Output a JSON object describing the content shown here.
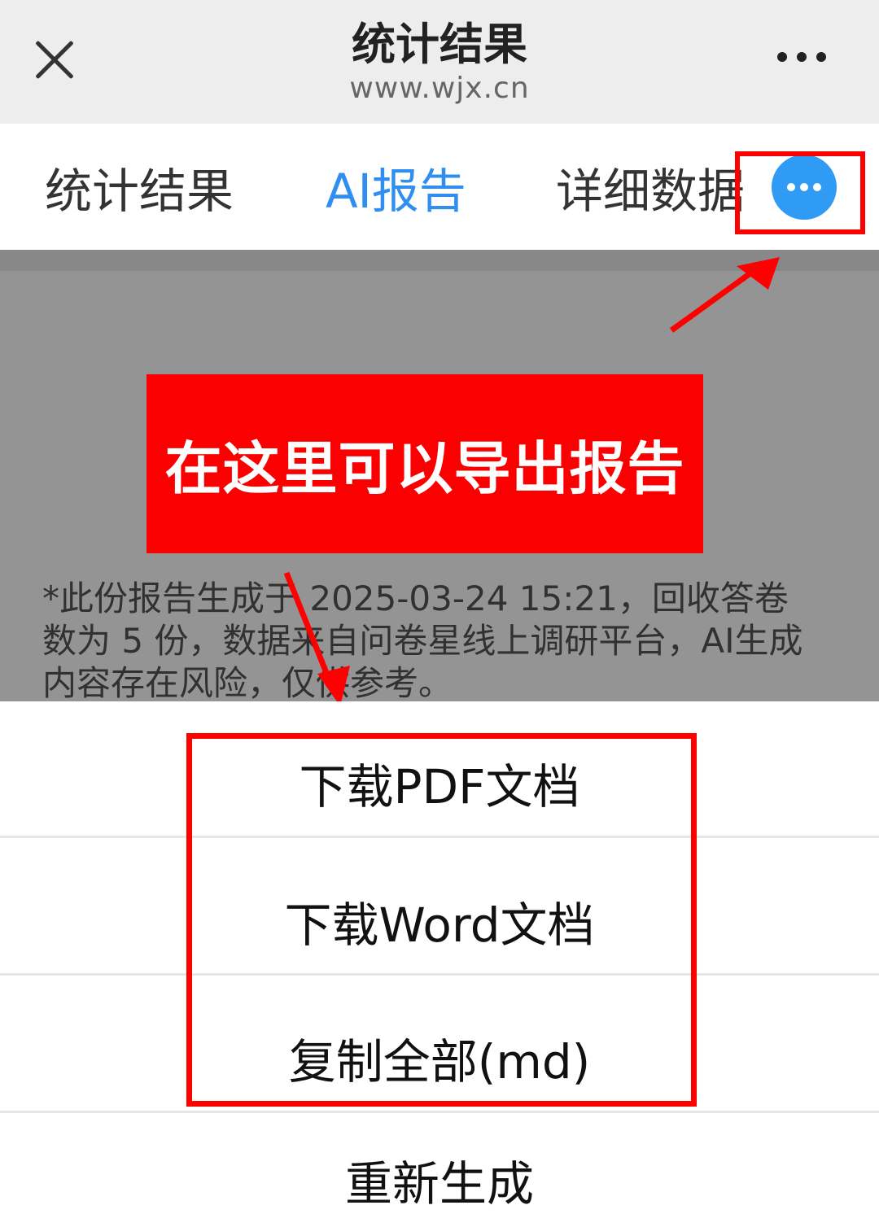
{
  "titlebar": {
    "title": "统计结果",
    "url": "www.wjx.cn",
    "close_icon": "close-icon",
    "more_icon": "more-horizontal-icon"
  },
  "tabs": [
    {
      "label": "统计结果",
      "active": false
    },
    {
      "label": "AI报告",
      "active": true
    },
    {
      "label": "详细数据",
      "active": false
    }
  ],
  "tab_more_icon": "more-circle-icon",
  "report_note": "*此份报告生成于 2025-03-24 15:21，回收答卷数为 5 份，数据来自问卷星线上调研平台，AI生成内容存在风险，仅供参考。",
  "annotation": {
    "banner_text": "在这里可以导出报告",
    "color": "#ff0000"
  },
  "action_sheet": {
    "items": [
      {
        "label": "下载PDF文档"
      },
      {
        "label": "下载Word文档"
      },
      {
        "label": "复制全部(md)"
      },
      {
        "label": "重新生成"
      }
    ]
  },
  "colors": {
    "accent": "#2f8ef0",
    "annotation_red": "#ff0000",
    "titlebar_bg": "#ededed"
  }
}
